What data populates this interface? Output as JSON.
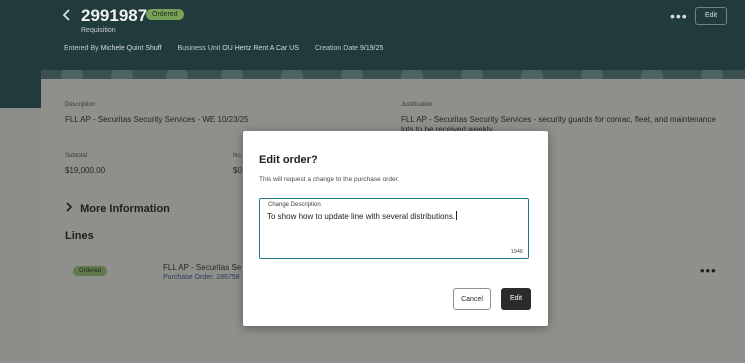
{
  "header": {
    "back_icon": "chevron-left-icon",
    "requisition_number": "2991987",
    "status_badge": "Ordered",
    "subtitle": "Requisition",
    "entered_by_label": "Entered By",
    "entered_by_value": "Michele Quint Shuff",
    "business_unit_label": "Business Unit",
    "business_unit_value": "OU Hertz Rent A Car US",
    "creation_date_label": "Creation Date",
    "creation_date_value": "9/19/25",
    "more_actions": "•••",
    "edit_label": "Edit"
  },
  "details": {
    "description_label": "Description",
    "description_value": "FLL AP - Securitas Security Services - WE 10/23/25",
    "justification_label": "Justification",
    "justification_value": "FLL AP - Securitas Security Services - security guards for conrac, fleet, and maintenance",
    "justification_value_2": "lots to be received weekly",
    "subtotal_label": "Subtotal",
    "subtotal_value": "$19,000.00",
    "col2_label": "No",
    "col2_value": "$0",
    "more_information": "More Information",
    "lines_heading": "Lines"
  },
  "line_item": {
    "status": "Ordered",
    "title": "FLL AP - Securitas Se",
    "purchase_order": "Purchase Order: 286758",
    "more_actions": "•••"
  },
  "modal": {
    "title": "Edit order?",
    "message": "This will request a change to the purchase order.",
    "field_label": "Change Description",
    "field_value": "To show how to update line with several distributions.",
    "char_counter": "1946",
    "cancel_label": "Cancel",
    "edit_label": "Edit"
  },
  "colors": {
    "header_bg": "#213a3b",
    "primary_button": "#2d2b29",
    "focus_border": "#227c86",
    "ordered_badge": "#78a25a"
  }
}
